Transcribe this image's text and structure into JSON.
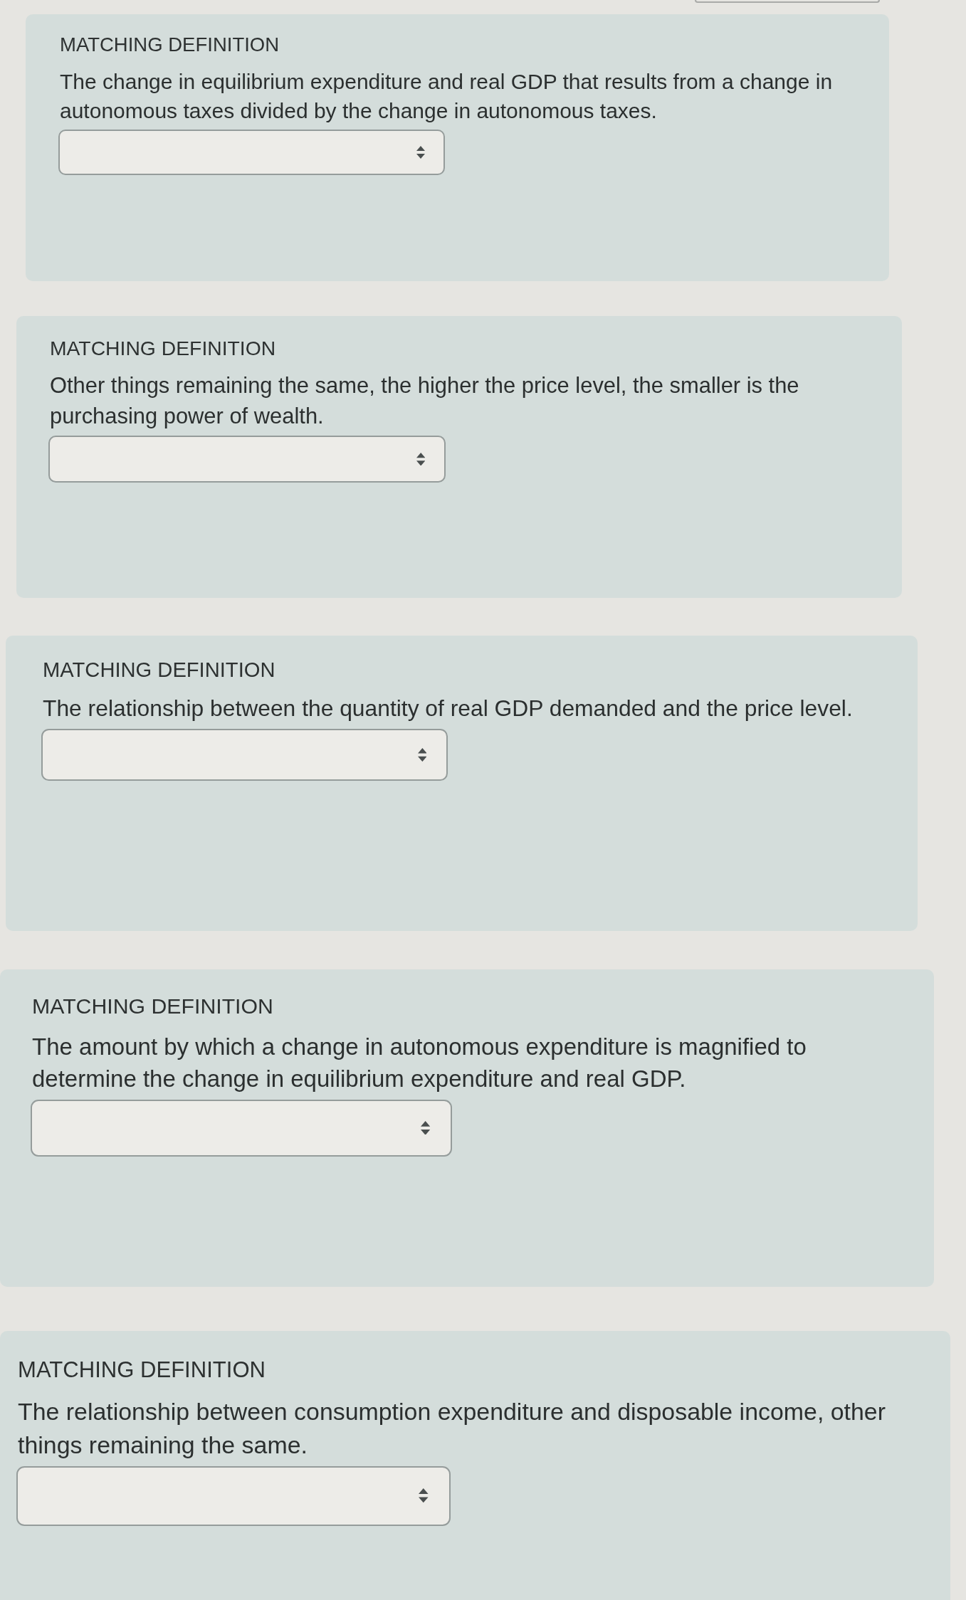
{
  "cards": [
    {
      "heading": "MATCHING DEFINITION",
      "definition": "The change in equilibrium expenditure and real GDP that results from a change in autonomous taxes divided by the change in autonomous taxes."
    },
    {
      "heading": "MATCHING DEFINITION",
      "definition": "Other things remaining the same, the higher the price level, the smaller is the purchasing power of wealth."
    },
    {
      "heading": "MATCHING DEFINITION",
      "definition": "The relationship between the quantity of real GDP demanded and the price level."
    },
    {
      "heading": "MATCHING DEFINITION",
      "definition": "The amount by which a change in autonomous expenditure is magnified to determine the change in equilibrium expenditure and real GDP."
    },
    {
      "heading": "MATCHING DEFINITION",
      "definition": "The relationship between consumption expenditure and disposable income, other things remaining the same."
    }
  ]
}
